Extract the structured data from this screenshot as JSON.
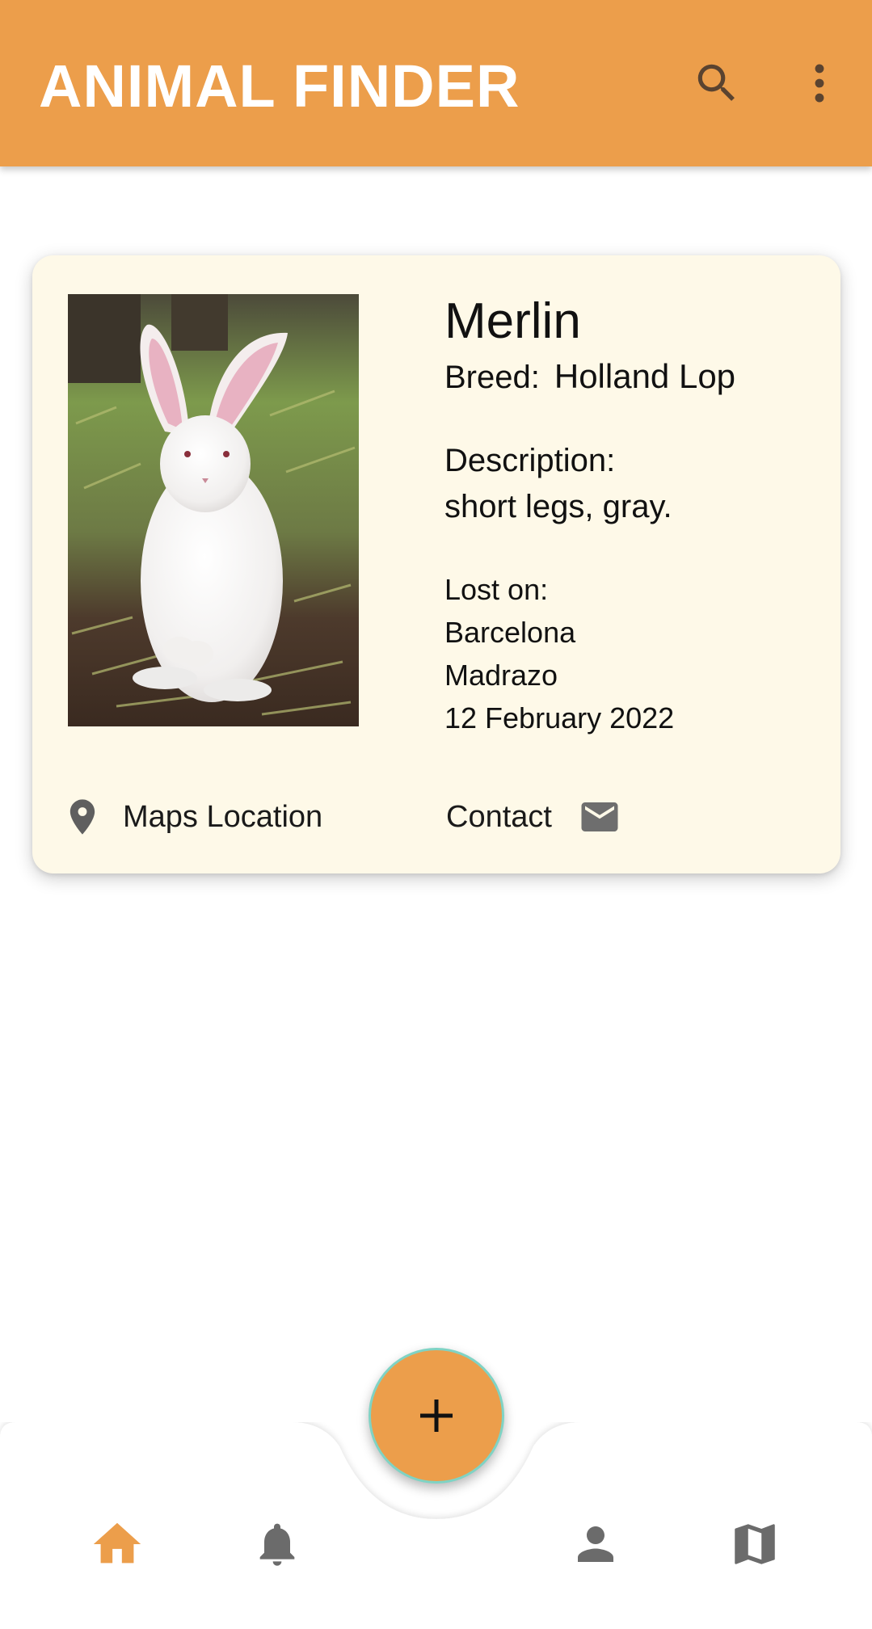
{
  "app_bar": {
    "title": "ANIMAL FINDER",
    "search_icon": "search-icon",
    "more_icon": "more-vert-icon"
  },
  "card": {
    "name": "Merlin",
    "breed_label": "Breed:",
    "breed": "Holland Lop",
    "description_label": "Description:",
    "description": "short legs, gray.",
    "lost_label": "Lost on:",
    "lost_city": "Barcelona",
    "lost_place": "Madrazo",
    "lost_date": "12 February 2022",
    "maps_label": "Maps Location",
    "contact_label": "Contact",
    "photo_subject": "white rabbit standing on grass"
  },
  "bottom_nav": {
    "items": [
      {
        "icon": "home-icon",
        "active": true
      },
      {
        "icon": "bell-icon",
        "active": false
      },
      {
        "icon": "person-icon",
        "active": false
      },
      {
        "icon": "map-icon",
        "active": false
      }
    ],
    "fab_icon": "plus-icon"
  },
  "colors": {
    "primary": "#EC9E4B",
    "icon_dark": "#5A4330",
    "card_background": "#FEF9E8",
    "nav_inactive": "#6B6B6B",
    "fab_border": "#7FD3C4"
  }
}
